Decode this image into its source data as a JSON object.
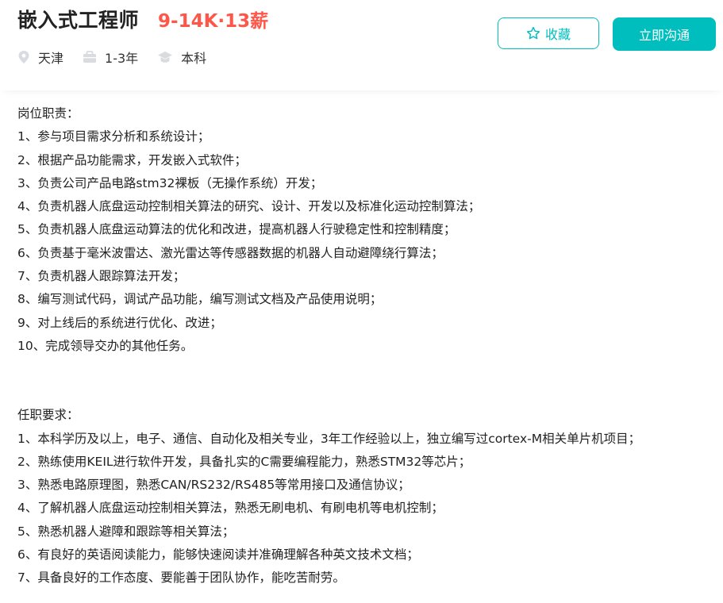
{
  "job": {
    "title": "嵌入式工程师",
    "salary": "9-14K·13薪",
    "location": "天津",
    "experience": "1-3年",
    "education": "本科"
  },
  "actions": {
    "collect_label": "收藏",
    "chat_label": "立即沟通"
  },
  "icons": {
    "location": "location-pin-icon",
    "experience": "briefcase-icon",
    "education": "graduation-cap-icon",
    "collect": "star-outline-icon"
  },
  "colors": {
    "salary": "#fe574a",
    "accent": "#00bebd"
  },
  "responsibilities": {
    "heading": "岗位职责：",
    "items": [
      "1、参与项目需求分析和系统设计；",
      "2、根据产品功能需求，开发嵌入式软件；",
      "3、负责公司产品电路stm32裸板（无操作系统）开发；",
      "4、负责机器人底盘运动控制相关算法的研究、设计、开发以及标准化运动控制算法；",
      "5、负责机器人底盘运动算法的优化和改进，提高机器人行驶稳定性和控制精度；",
      "6、负责基于毫米波雷达、激光雷达等传感器数据的机器人自动避障绕行算法；",
      "7、负责机器人跟踪算法开发；",
      "8、编写测试代码，调试产品功能，编写测试文档及产品使用说明；",
      "9、对上线后的系统进行优化、改进；",
      "10、完成领导交办的其他任务。"
    ]
  },
  "requirements": {
    "heading": "任职要求：",
    "items": [
      "1、本科学历及以上，电子、通信、自动化及相关专业，3年工作经验以上，独立编写过cortex-M相关单片机项目；",
      "2、熟练使用KEIL进行软件开发，具备扎实的C需要编程能力，熟悉STM32等芯片；",
      "3、熟悉电路原理图，熟悉CAN/RS232/RS485等常用接口及通信协议；",
      "4、了解机器人底盘运动控制相关算法，熟悉无刷电机、有刷电机等电机控制；",
      "5、熟悉机器人避障和跟踪等相关算法；",
      "6、有良好的英语阅读能力，能够快速阅读并准确理解各种英文技术文档；",
      "7、具备良好的工作态度、要能善于团队协作，能吃苦耐劳。"
    ]
  }
}
